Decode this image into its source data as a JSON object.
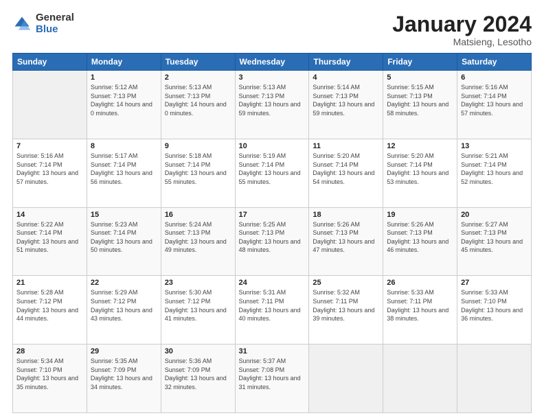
{
  "logo": {
    "general": "General",
    "blue": "Blue"
  },
  "header": {
    "month": "January 2024",
    "location": "Matsieng, Lesotho"
  },
  "weekdays": [
    "Sunday",
    "Monday",
    "Tuesday",
    "Wednesday",
    "Thursday",
    "Friday",
    "Saturday"
  ],
  "weeks": [
    [
      {
        "day": "",
        "sunrise": "",
        "sunset": "",
        "daylight": ""
      },
      {
        "day": "1",
        "sunrise": "Sunrise: 5:12 AM",
        "sunset": "Sunset: 7:13 PM",
        "daylight": "Daylight: 14 hours and 0 minutes."
      },
      {
        "day": "2",
        "sunrise": "Sunrise: 5:13 AM",
        "sunset": "Sunset: 7:13 PM",
        "daylight": "Daylight: 14 hours and 0 minutes."
      },
      {
        "day": "3",
        "sunrise": "Sunrise: 5:13 AM",
        "sunset": "Sunset: 7:13 PM",
        "daylight": "Daylight: 13 hours and 59 minutes."
      },
      {
        "day": "4",
        "sunrise": "Sunrise: 5:14 AM",
        "sunset": "Sunset: 7:13 PM",
        "daylight": "Daylight: 13 hours and 59 minutes."
      },
      {
        "day": "5",
        "sunrise": "Sunrise: 5:15 AM",
        "sunset": "Sunset: 7:13 PM",
        "daylight": "Daylight: 13 hours and 58 minutes."
      },
      {
        "day": "6",
        "sunrise": "Sunrise: 5:16 AM",
        "sunset": "Sunset: 7:14 PM",
        "daylight": "Daylight: 13 hours and 57 minutes."
      }
    ],
    [
      {
        "day": "7",
        "sunrise": "Sunrise: 5:16 AM",
        "sunset": "Sunset: 7:14 PM",
        "daylight": "Daylight: 13 hours and 57 minutes."
      },
      {
        "day": "8",
        "sunrise": "Sunrise: 5:17 AM",
        "sunset": "Sunset: 7:14 PM",
        "daylight": "Daylight: 13 hours and 56 minutes."
      },
      {
        "day": "9",
        "sunrise": "Sunrise: 5:18 AM",
        "sunset": "Sunset: 7:14 PM",
        "daylight": "Daylight: 13 hours and 55 minutes."
      },
      {
        "day": "10",
        "sunrise": "Sunrise: 5:19 AM",
        "sunset": "Sunset: 7:14 PM",
        "daylight": "Daylight: 13 hours and 55 minutes."
      },
      {
        "day": "11",
        "sunrise": "Sunrise: 5:20 AM",
        "sunset": "Sunset: 7:14 PM",
        "daylight": "Daylight: 13 hours and 54 minutes."
      },
      {
        "day": "12",
        "sunrise": "Sunrise: 5:20 AM",
        "sunset": "Sunset: 7:14 PM",
        "daylight": "Daylight: 13 hours and 53 minutes."
      },
      {
        "day": "13",
        "sunrise": "Sunrise: 5:21 AM",
        "sunset": "Sunset: 7:14 PM",
        "daylight": "Daylight: 13 hours and 52 minutes."
      }
    ],
    [
      {
        "day": "14",
        "sunrise": "Sunrise: 5:22 AM",
        "sunset": "Sunset: 7:14 PM",
        "daylight": "Daylight: 13 hours and 51 minutes."
      },
      {
        "day": "15",
        "sunrise": "Sunrise: 5:23 AM",
        "sunset": "Sunset: 7:14 PM",
        "daylight": "Daylight: 13 hours and 50 minutes."
      },
      {
        "day": "16",
        "sunrise": "Sunrise: 5:24 AM",
        "sunset": "Sunset: 7:13 PM",
        "daylight": "Daylight: 13 hours and 49 minutes."
      },
      {
        "day": "17",
        "sunrise": "Sunrise: 5:25 AM",
        "sunset": "Sunset: 7:13 PM",
        "daylight": "Daylight: 13 hours and 48 minutes."
      },
      {
        "day": "18",
        "sunrise": "Sunrise: 5:26 AM",
        "sunset": "Sunset: 7:13 PM",
        "daylight": "Daylight: 13 hours and 47 minutes."
      },
      {
        "day": "19",
        "sunrise": "Sunrise: 5:26 AM",
        "sunset": "Sunset: 7:13 PM",
        "daylight": "Daylight: 13 hours and 46 minutes."
      },
      {
        "day": "20",
        "sunrise": "Sunrise: 5:27 AM",
        "sunset": "Sunset: 7:13 PM",
        "daylight": "Daylight: 13 hours and 45 minutes."
      }
    ],
    [
      {
        "day": "21",
        "sunrise": "Sunrise: 5:28 AM",
        "sunset": "Sunset: 7:12 PM",
        "daylight": "Daylight: 13 hours and 44 minutes."
      },
      {
        "day": "22",
        "sunrise": "Sunrise: 5:29 AM",
        "sunset": "Sunset: 7:12 PM",
        "daylight": "Daylight: 13 hours and 43 minutes."
      },
      {
        "day": "23",
        "sunrise": "Sunrise: 5:30 AM",
        "sunset": "Sunset: 7:12 PM",
        "daylight": "Daylight: 13 hours and 41 minutes."
      },
      {
        "day": "24",
        "sunrise": "Sunrise: 5:31 AM",
        "sunset": "Sunset: 7:11 PM",
        "daylight": "Daylight: 13 hours and 40 minutes."
      },
      {
        "day": "25",
        "sunrise": "Sunrise: 5:32 AM",
        "sunset": "Sunset: 7:11 PM",
        "daylight": "Daylight: 13 hours and 39 minutes."
      },
      {
        "day": "26",
        "sunrise": "Sunrise: 5:33 AM",
        "sunset": "Sunset: 7:11 PM",
        "daylight": "Daylight: 13 hours and 38 minutes."
      },
      {
        "day": "27",
        "sunrise": "Sunrise: 5:33 AM",
        "sunset": "Sunset: 7:10 PM",
        "daylight": "Daylight: 13 hours and 36 minutes."
      }
    ],
    [
      {
        "day": "28",
        "sunrise": "Sunrise: 5:34 AM",
        "sunset": "Sunset: 7:10 PM",
        "daylight": "Daylight: 13 hours and 35 minutes."
      },
      {
        "day": "29",
        "sunrise": "Sunrise: 5:35 AM",
        "sunset": "Sunset: 7:09 PM",
        "daylight": "Daylight: 13 hours and 34 minutes."
      },
      {
        "day": "30",
        "sunrise": "Sunrise: 5:36 AM",
        "sunset": "Sunset: 7:09 PM",
        "daylight": "Daylight: 13 hours and 32 minutes."
      },
      {
        "day": "31",
        "sunrise": "Sunrise: 5:37 AM",
        "sunset": "Sunset: 7:08 PM",
        "daylight": "Daylight: 13 hours and 31 minutes."
      },
      {
        "day": "",
        "sunrise": "",
        "sunset": "",
        "daylight": ""
      },
      {
        "day": "",
        "sunrise": "",
        "sunset": "",
        "daylight": ""
      },
      {
        "day": "",
        "sunrise": "",
        "sunset": "",
        "daylight": ""
      }
    ]
  ]
}
